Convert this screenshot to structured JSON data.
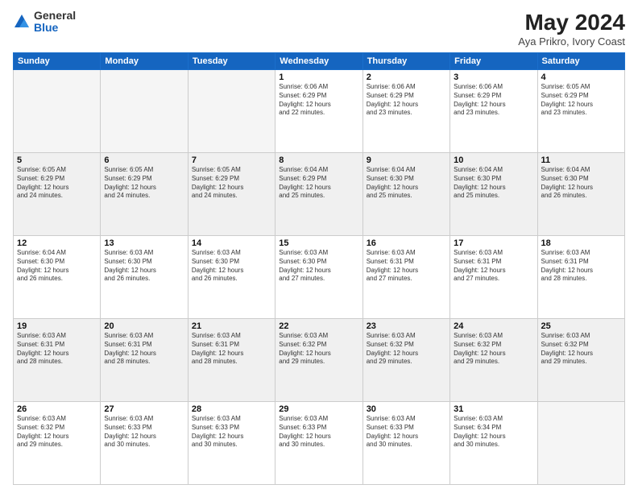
{
  "logo": {
    "general": "General",
    "blue": "Blue"
  },
  "title": "May 2024",
  "subtitle": "Aya Prikro, Ivory Coast",
  "header_days": [
    "Sunday",
    "Monday",
    "Tuesday",
    "Wednesday",
    "Thursday",
    "Friday",
    "Saturday"
  ],
  "weeks": [
    [
      {
        "day": "",
        "detail": "",
        "empty": true
      },
      {
        "day": "",
        "detail": "",
        "empty": true
      },
      {
        "day": "",
        "detail": "",
        "empty": true
      },
      {
        "day": "1",
        "detail": "Sunrise: 6:06 AM\nSunset: 6:29 PM\nDaylight: 12 hours\nand 22 minutes."
      },
      {
        "day": "2",
        "detail": "Sunrise: 6:06 AM\nSunset: 6:29 PM\nDaylight: 12 hours\nand 23 minutes."
      },
      {
        "day": "3",
        "detail": "Sunrise: 6:06 AM\nSunset: 6:29 PM\nDaylight: 12 hours\nand 23 minutes."
      },
      {
        "day": "4",
        "detail": "Sunrise: 6:05 AM\nSunset: 6:29 PM\nDaylight: 12 hours\nand 23 minutes."
      }
    ],
    [
      {
        "day": "5",
        "detail": "Sunrise: 6:05 AM\nSunset: 6:29 PM\nDaylight: 12 hours\nand 24 minutes.",
        "shaded": true
      },
      {
        "day": "6",
        "detail": "Sunrise: 6:05 AM\nSunset: 6:29 PM\nDaylight: 12 hours\nand 24 minutes.",
        "shaded": true
      },
      {
        "day": "7",
        "detail": "Sunrise: 6:05 AM\nSunset: 6:29 PM\nDaylight: 12 hours\nand 24 minutes.",
        "shaded": true
      },
      {
        "day": "8",
        "detail": "Sunrise: 6:04 AM\nSunset: 6:29 PM\nDaylight: 12 hours\nand 25 minutes.",
        "shaded": true
      },
      {
        "day": "9",
        "detail": "Sunrise: 6:04 AM\nSunset: 6:30 PM\nDaylight: 12 hours\nand 25 minutes.",
        "shaded": true
      },
      {
        "day": "10",
        "detail": "Sunrise: 6:04 AM\nSunset: 6:30 PM\nDaylight: 12 hours\nand 25 minutes.",
        "shaded": true
      },
      {
        "day": "11",
        "detail": "Sunrise: 6:04 AM\nSunset: 6:30 PM\nDaylight: 12 hours\nand 26 minutes.",
        "shaded": true
      }
    ],
    [
      {
        "day": "12",
        "detail": "Sunrise: 6:04 AM\nSunset: 6:30 PM\nDaylight: 12 hours\nand 26 minutes."
      },
      {
        "day": "13",
        "detail": "Sunrise: 6:03 AM\nSunset: 6:30 PM\nDaylight: 12 hours\nand 26 minutes."
      },
      {
        "day": "14",
        "detail": "Sunrise: 6:03 AM\nSunset: 6:30 PM\nDaylight: 12 hours\nand 26 minutes."
      },
      {
        "day": "15",
        "detail": "Sunrise: 6:03 AM\nSunset: 6:30 PM\nDaylight: 12 hours\nand 27 minutes."
      },
      {
        "day": "16",
        "detail": "Sunrise: 6:03 AM\nSunset: 6:31 PM\nDaylight: 12 hours\nand 27 minutes."
      },
      {
        "day": "17",
        "detail": "Sunrise: 6:03 AM\nSunset: 6:31 PM\nDaylight: 12 hours\nand 27 minutes."
      },
      {
        "day": "18",
        "detail": "Sunrise: 6:03 AM\nSunset: 6:31 PM\nDaylight: 12 hours\nand 28 minutes."
      }
    ],
    [
      {
        "day": "19",
        "detail": "Sunrise: 6:03 AM\nSunset: 6:31 PM\nDaylight: 12 hours\nand 28 minutes.",
        "shaded": true
      },
      {
        "day": "20",
        "detail": "Sunrise: 6:03 AM\nSunset: 6:31 PM\nDaylight: 12 hours\nand 28 minutes.",
        "shaded": true
      },
      {
        "day": "21",
        "detail": "Sunrise: 6:03 AM\nSunset: 6:31 PM\nDaylight: 12 hours\nand 28 minutes.",
        "shaded": true
      },
      {
        "day": "22",
        "detail": "Sunrise: 6:03 AM\nSunset: 6:32 PM\nDaylight: 12 hours\nand 29 minutes.",
        "shaded": true
      },
      {
        "day": "23",
        "detail": "Sunrise: 6:03 AM\nSunset: 6:32 PM\nDaylight: 12 hours\nand 29 minutes.",
        "shaded": true
      },
      {
        "day": "24",
        "detail": "Sunrise: 6:03 AM\nSunset: 6:32 PM\nDaylight: 12 hours\nand 29 minutes.",
        "shaded": true
      },
      {
        "day": "25",
        "detail": "Sunrise: 6:03 AM\nSunset: 6:32 PM\nDaylight: 12 hours\nand 29 minutes.",
        "shaded": true
      }
    ],
    [
      {
        "day": "26",
        "detail": "Sunrise: 6:03 AM\nSunset: 6:32 PM\nDaylight: 12 hours\nand 29 minutes."
      },
      {
        "day": "27",
        "detail": "Sunrise: 6:03 AM\nSunset: 6:33 PM\nDaylight: 12 hours\nand 30 minutes."
      },
      {
        "day": "28",
        "detail": "Sunrise: 6:03 AM\nSunset: 6:33 PM\nDaylight: 12 hours\nand 30 minutes."
      },
      {
        "day": "29",
        "detail": "Sunrise: 6:03 AM\nSunset: 6:33 PM\nDaylight: 12 hours\nand 30 minutes."
      },
      {
        "day": "30",
        "detail": "Sunrise: 6:03 AM\nSunset: 6:33 PM\nDaylight: 12 hours\nand 30 minutes."
      },
      {
        "day": "31",
        "detail": "Sunrise: 6:03 AM\nSunset: 6:34 PM\nDaylight: 12 hours\nand 30 minutes."
      },
      {
        "day": "",
        "detail": "",
        "empty": true
      }
    ]
  ]
}
